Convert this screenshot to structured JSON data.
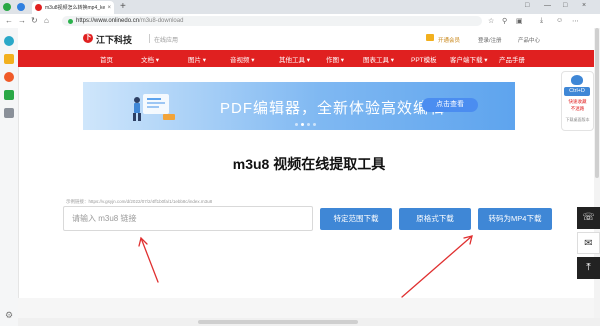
{
  "browser": {
    "tab_title": "m3u8视频怎么转换mp4_ke...",
    "tab_close": "×",
    "new_tab": "+",
    "url_host": "https://www.onlinedo.cn",
    "url_path": "/m3u8-download",
    "window_controls": [
      "□",
      "—",
      "□",
      "×"
    ]
  },
  "site": {
    "logo_mark": "下",
    "logo_text": "江下科技",
    "logo_sub": "在线应用",
    "header_links": [
      "开通会员",
      "登录/注册",
      "产品中心"
    ],
    "nav": [
      "首页",
      "文档 ▾",
      "图片 ▾",
      "音视频 ▾",
      "其他工具 ▾",
      "作图 ▾",
      "图表工具 ▾",
      "PPT模板",
      "客户端下载 ▾",
      "产品手册"
    ]
  },
  "banner": {
    "title": "PDF编辑器，全新体验高效编辑",
    "button": "点击查看"
  },
  "main": {
    "title": "m3u8 视频在线提取工具",
    "example": "示例链接：https://v.gsyjn.com/d/2022/07/2/4ff1b0fa/1/1ebb8c/index.m3u8",
    "input_placeholder": "请输入 m3u8 链接",
    "buttons": [
      "特定范围下载",
      "原格式下载",
      "转码为MP4下载"
    ]
  },
  "float": {
    "fav_key": "Ctrl+D",
    "fav_line1": "快速收藏",
    "fav_line2": "不迷路",
    "fav_line3": "下载桌面版本"
  },
  "colors": {
    "brand_red": "#e02020",
    "button_blue": "#3f87d6",
    "arrow_red": "#e03030"
  }
}
